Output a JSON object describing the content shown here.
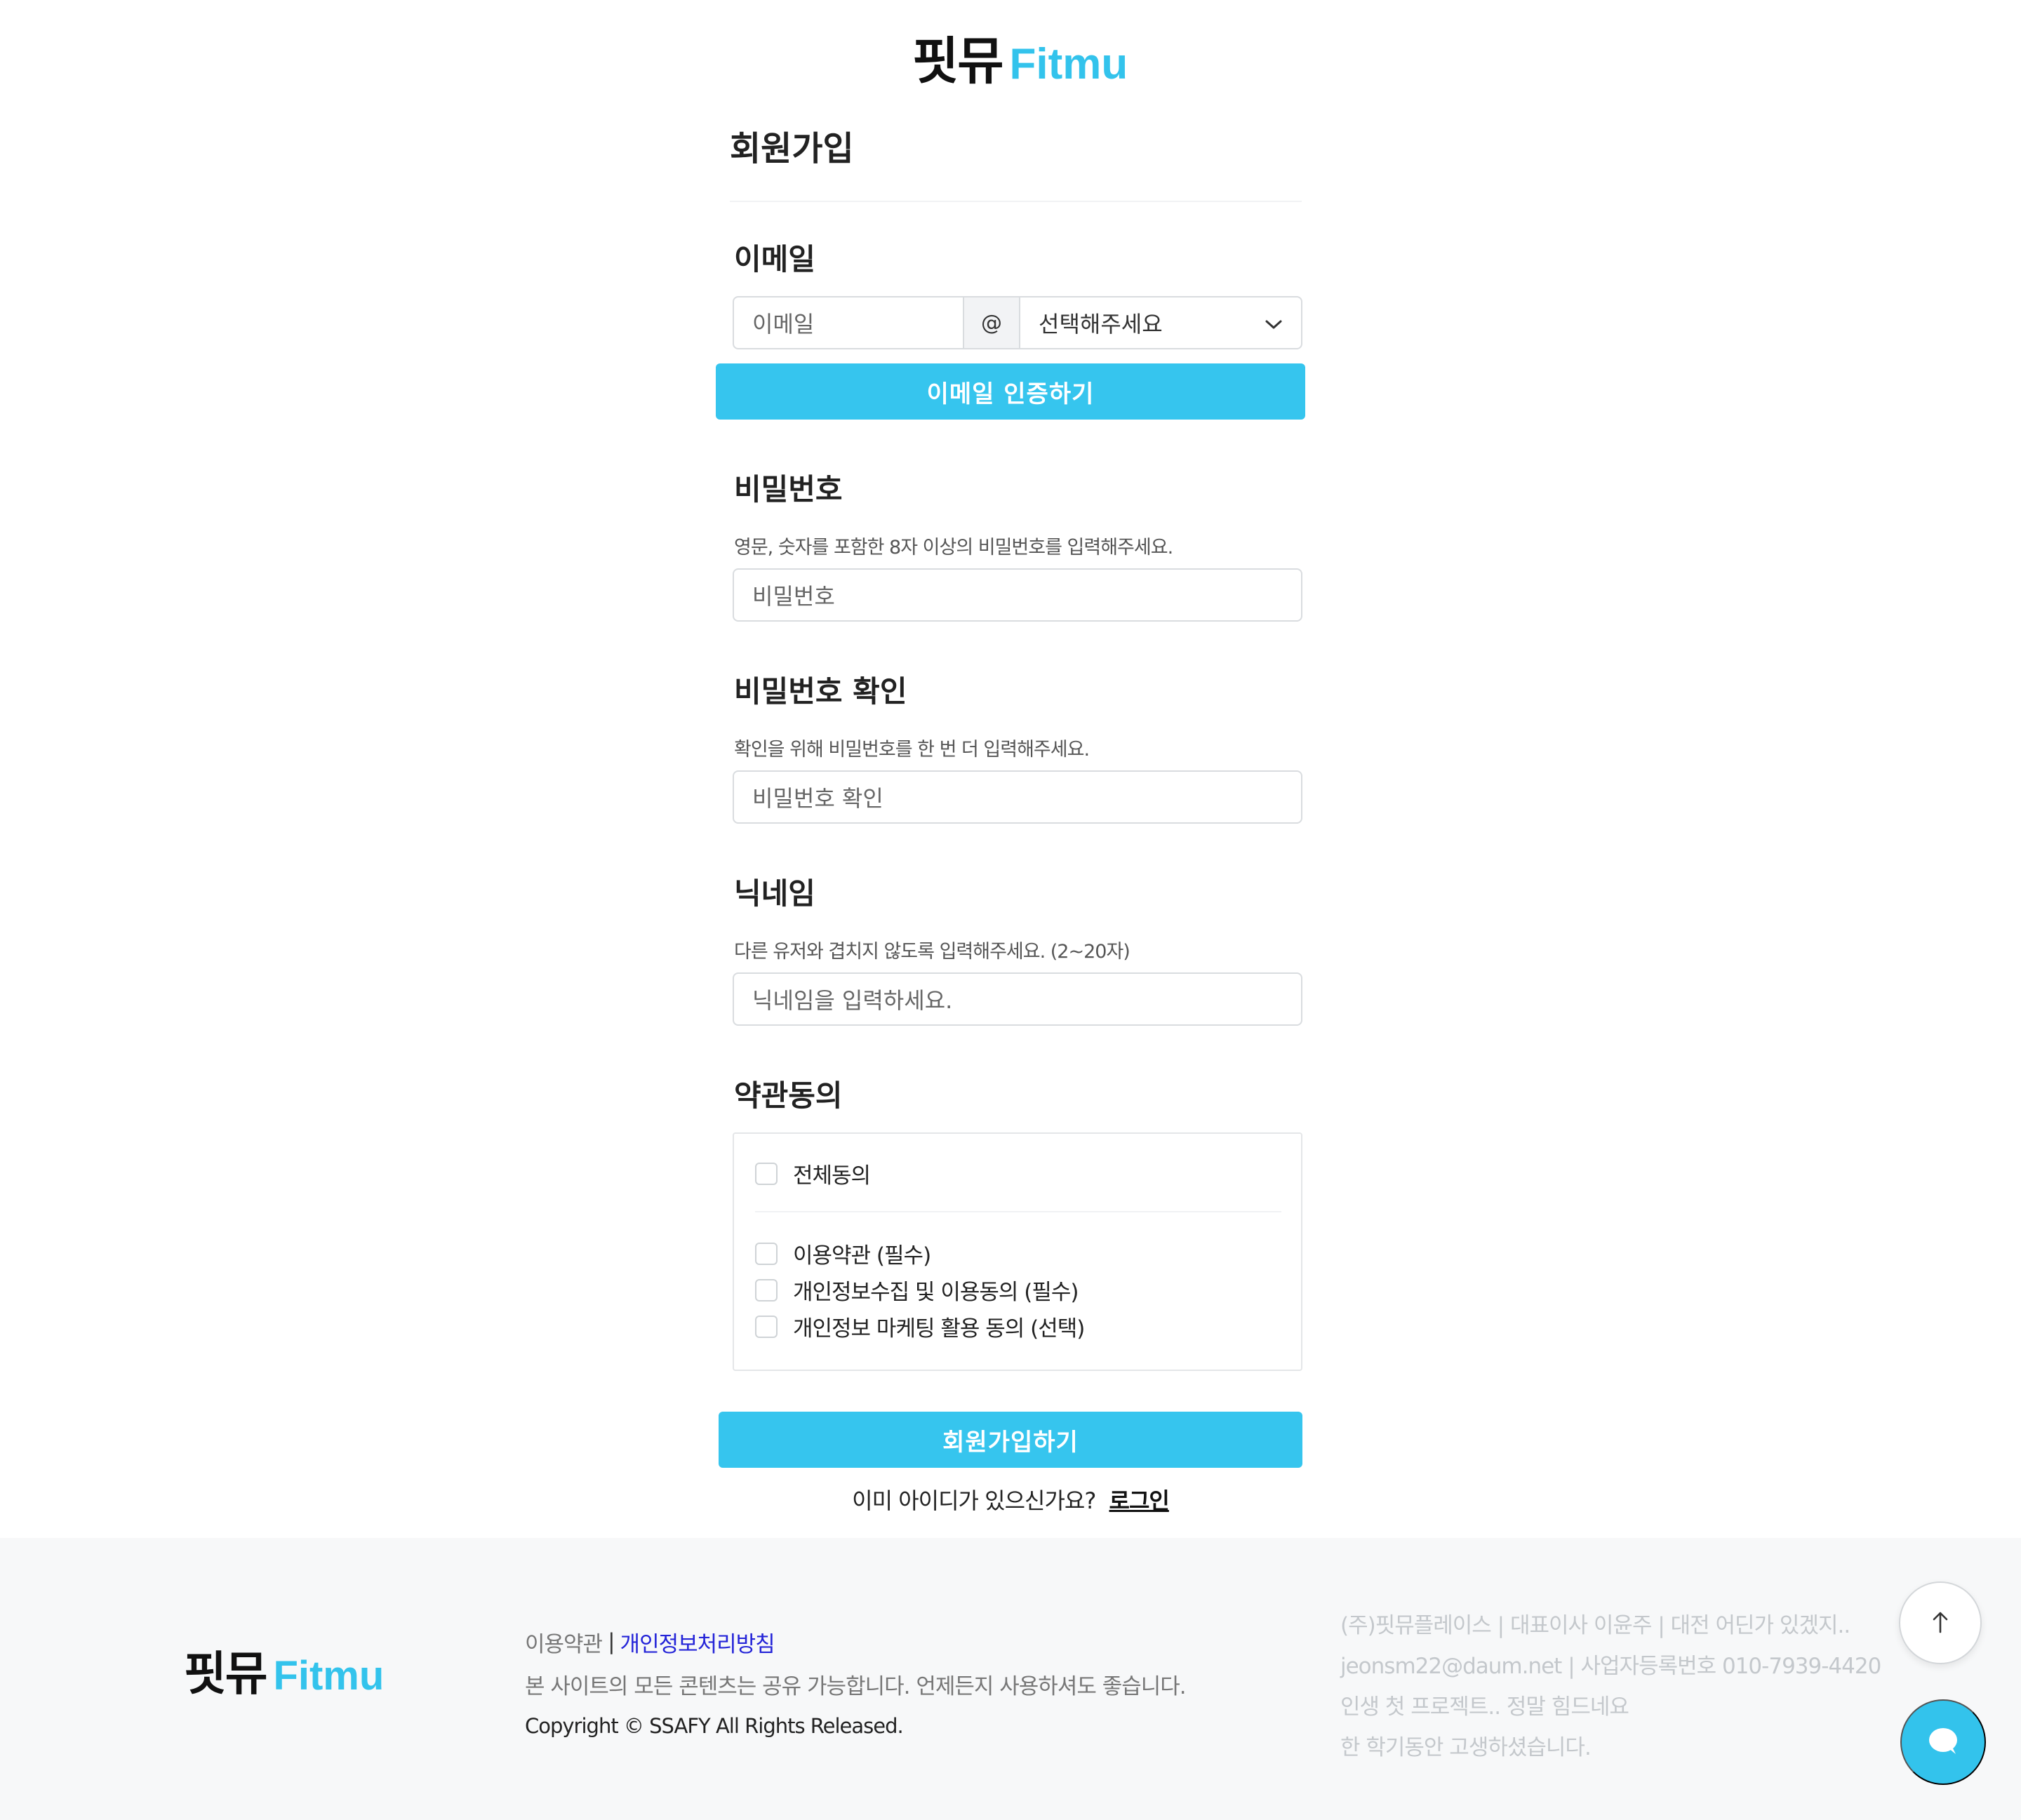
{
  "header": {
    "logo_ko": "핏뮤",
    "logo_en": "Fitmu"
  },
  "signup": {
    "title": "회원가입",
    "email": {
      "label": "이메일",
      "local_placeholder": "이메일",
      "at": "@",
      "domain_selected": "선택해주세요",
      "verify_button": "이메일 인증하기"
    },
    "password": {
      "label": "비밀번호",
      "hint": "영문, 숫자를 포함한 8자 이상의 비밀번호를 입력해주세요.",
      "placeholder": "비밀번호"
    },
    "password_confirm": {
      "label": "비밀번호 확인",
      "hint": "확인을 위해 비밀번호를 한 번 더 입력해주세요.",
      "placeholder": "비밀번호 확인"
    },
    "nickname": {
      "label": "닉네임",
      "hint": "다른 유저와 겹치지 않도록 입력해주세요. (2~20자)",
      "placeholder": "닉네임을 입력하세요."
    },
    "terms": {
      "label": "약관동의",
      "all": "전체동의",
      "items": [
        "이용약관 (필수)",
        "개인정보수집 및 이용동의 (필수)",
        "개인정보 마케팅 활용 동의 (선택)"
      ]
    },
    "submit_button": "회원가입하기",
    "login_prompt": "이미 아이디가 있으신가요?",
    "login_link": "로그인"
  },
  "footer": {
    "logo_ko": "핏뮤",
    "logo_en": "Fitmu",
    "terms_link": "이용약관",
    "separator": "|",
    "privacy_link": "개인정보처리방침",
    "notice": "본 사이트의 모든 콘텐츠는 공유 가능합니다. 언제든지 사용하셔도 좋습니다.",
    "copyright": "Copyright © SSAFY All Rights Released.",
    "company_lines": [
      "(주)핏뮤플레이스 | 대표이사 이윤주 | 대전 어딘가 있겠지..",
      "jeonsm22@daum.net | 사업자등록번호 010-7939-4420",
      "인생 첫 프로젝트.. 정말 힘드네요",
      "한 학기동안 고생하셨습니다."
    ]
  },
  "colors": {
    "accent": "#36c5ee",
    "policy_link": "#2424d8",
    "footer_bg": "#f7f8f9"
  },
  "icons": {
    "dropdown": "chevron-down-icon",
    "scroll_top": "arrow-up-icon",
    "chat": "chat-bubble-icon"
  }
}
